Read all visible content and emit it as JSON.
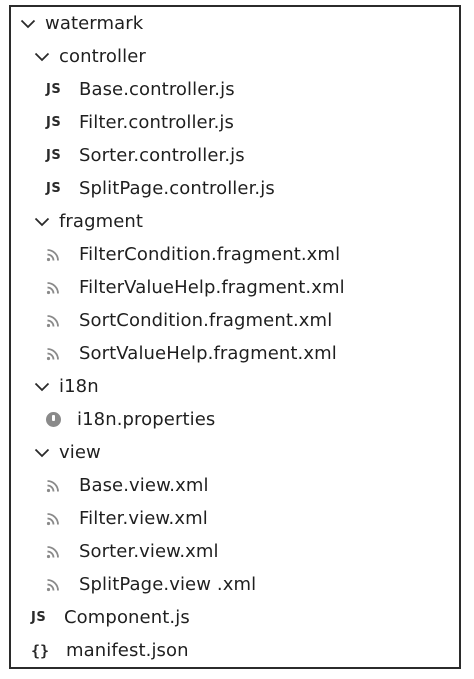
{
  "explorer": {
    "root": {
      "label": "watermark",
      "expanded": true,
      "icon": "chevron-down-icon"
    },
    "items": [
      {
        "label": "controller",
        "type": "folder",
        "icon": "chevron-down-icon"
      },
      {
        "label": "Base.controller.js",
        "type": "file",
        "icon": "js-file-icon",
        "icon_text": "JS"
      },
      {
        "label": "Filter.controller.js",
        "type": "file",
        "icon": "js-file-icon",
        "icon_text": "JS"
      },
      {
        "label": "Sorter.controller.js",
        "type": "file",
        "icon": "js-file-icon",
        "icon_text": "JS"
      },
      {
        "label": "SplitPage.controller.js",
        "type": "file",
        "icon": "js-file-icon",
        "icon_text": "JS"
      },
      {
        "label": "fragment",
        "type": "folder",
        "icon": "chevron-down-icon"
      },
      {
        "label": "FilterCondition.fragment.xml",
        "type": "file",
        "icon": "xml-file-icon"
      },
      {
        "label": "FilterValueHelp.fragment.xml",
        "type": "file",
        "icon": "xml-file-icon"
      },
      {
        "label": "SortCondition.fragment.xml",
        "type": "file",
        "icon": "xml-file-icon"
      },
      {
        "label": "SortValueHelp.fragment.xml",
        "type": "file",
        "icon": "xml-file-icon"
      },
      {
        "label": "i18n",
        "type": "folder",
        "icon": "chevron-down-icon"
      },
      {
        "label": "i18n.properties",
        "type": "file",
        "icon": "properties-file-icon"
      },
      {
        "label": "view",
        "type": "folder",
        "icon": "chevron-down-icon"
      },
      {
        "label": "Base.view.xml",
        "type": "file",
        "icon": "xml-file-icon"
      },
      {
        "label": "Filter.view.xml",
        "type": "file",
        "icon": "xml-file-icon"
      },
      {
        "label": "Sorter.view.xml",
        "type": "file",
        "icon": "xml-file-icon"
      },
      {
        "label": "SplitPage.view .xml",
        "type": "file",
        "icon": "xml-file-icon"
      },
      {
        "label": "Component.js",
        "type": "file",
        "icon": "js-file-icon",
        "icon_text": "JS"
      },
      {
        "label": "manifest.json",
        "type": "file",
        "icon": "json-file-icon",
        "icon_text": "{}"
      }
    ]
  }
}
